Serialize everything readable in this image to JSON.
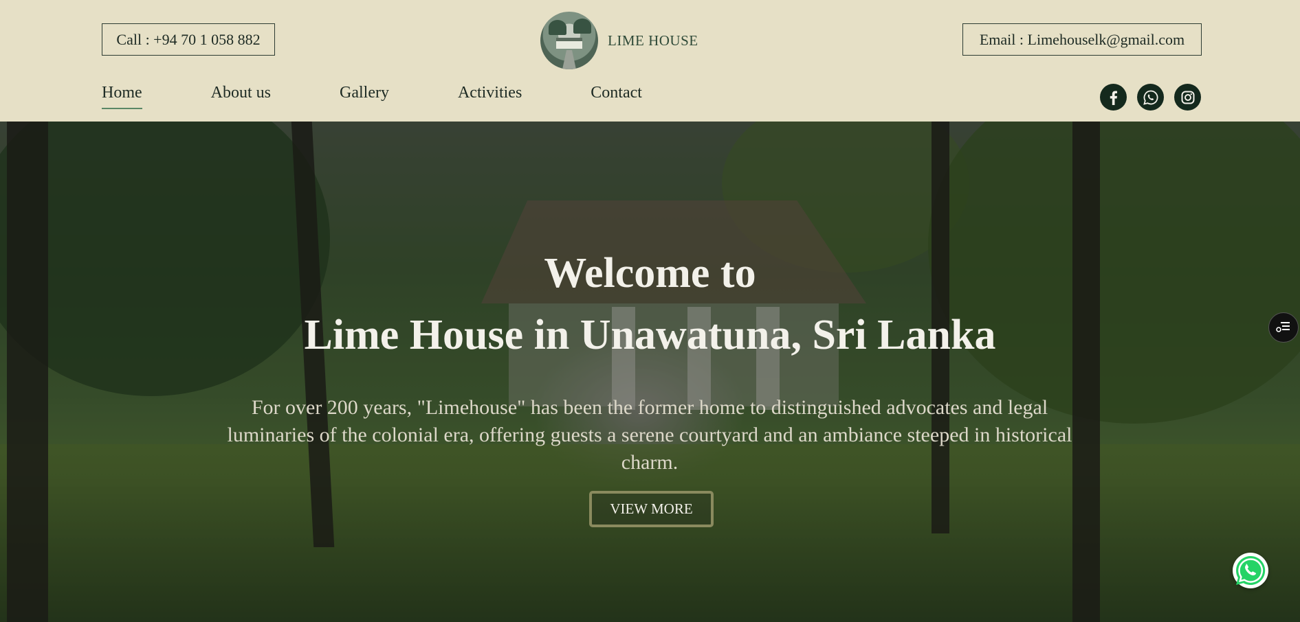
{
  "header": {
    "call_text": "Call : +94 70 1 058 882",
    "email_text": "Email : Limehouselk@gmail.com",
    "brand_name": "LIME HOUSE"
  },
  "nav": {
    "items": [
      {
        "label": "Home",
        "active": true
      },
      {
        "label": "About us",
        "active": false
      },
      {
        "label": "Gallery",
        "active": false
      },
      {
        "label": "Activities",
        "active": false
      },
      {
        "label": "Contact",
        "active": false
      }
    ]
  },
  "socials": [
    {
      "icon": "facebook-icon"
    },
    {
      "icon": "whatsapp-icon"
    },
    {
      "icon": "instagram-icon"
    }
  ],
  "hero": {
    "title_line1": "Welcome to",
    "title_line2": "Lime House in Unawatuna, Sri Lanka",
    "description": "For over 200 years, \"Limehouse\" has been the former home to distinguished advocates and legal luminaries of the colonial era, offering guests a serene courtyard and an ambiance steeped in historical charm.",
    "button_label": "VIEW MORE"
  },
  "floating": {
    "side_icon": "filter-list-icon",
    "chat_icon": "whatsapp-icon"
  },
  "colors": {
    "header_bg": "#e6e0c6",
    "social_bg": "#14291d",
    "nav_underline": "#5a8766",
    "button_border": "#8a8a5e",
    "whatsapp_green": "#25d366"
  }
}
